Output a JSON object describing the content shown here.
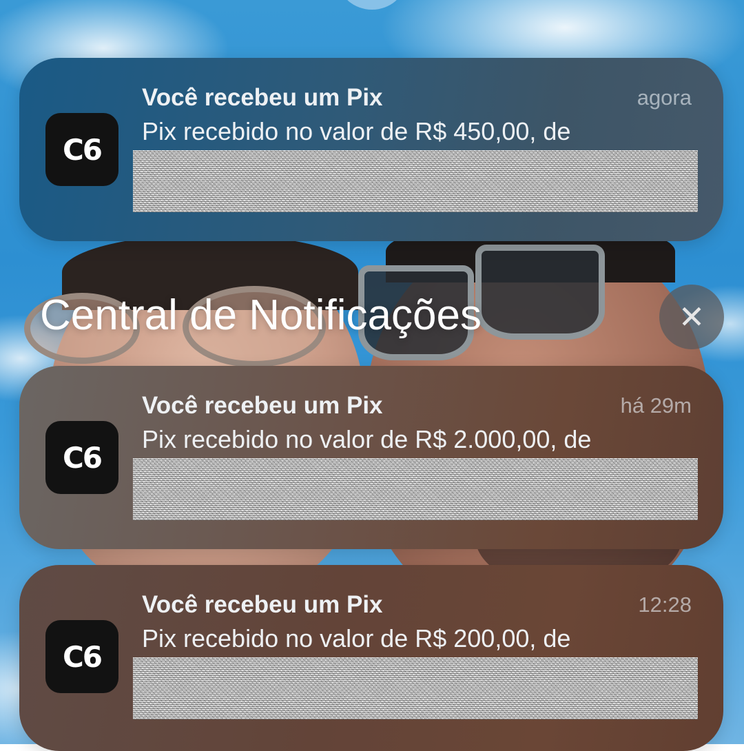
{
  "section": {
    "title": "Central de Notificações",
    "close_icon": "close-icon"
  },
  "notifications": [
    {
      "app_icon_text": "C6",
      "title": "Você recebeu um Pix",
      "time": "agora",
      "body": "Pix recebido no valor de R$ 450,00, de"
    },
    {
      "app_icon_text": "C6",
      "title": "Você recebeu um Pix",
      "time": "há 29m",
      "body": "Pix recebido no valor de R$ 2.000,00, de"
    },
    {
      "app_icon_text": "C6",
      "title": "Você recebeu um Pix",
      "time": "12:28",
      "body": "Pix recebido no valor de R$ 200,00, de"
    }
  ],
  "colors": {
    "app_icon_bg": "#121212",
    "text": "#eef1f4"
  }
}
